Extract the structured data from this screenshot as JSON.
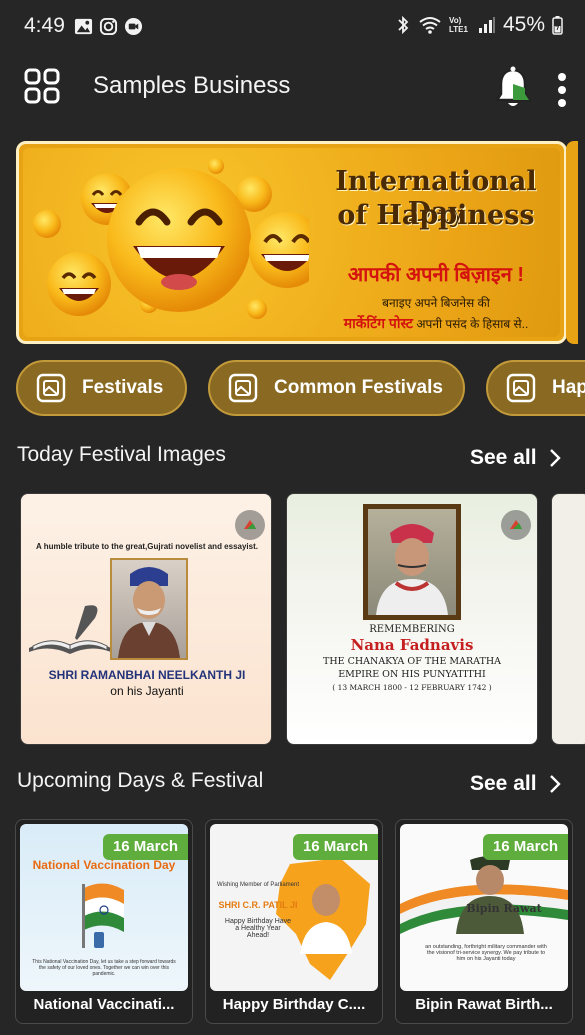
{
  "status_bar": {
    "time": "4:49",
    "signal_text": "Vo) LTE1",
    "battery": "45%"
  },
  "app_bar": {
    "title": "Samples Business",
    "menu_icon": "grid-icon",
    "notification_icon": "bell-icon",
    "more_icon": "kebab-icon"
  },
  "banner": {
    "line1": "International Day",
    "line2": "of Happiness",
    "hindi_title": "आपकी अपनी बिज़ाइन !",
    "hindi_line1": "बनाइए अपने बिजनेस की",
    "hindi_highlight": "मार्केटिंग पोस्ट",
    "hindi_line2": "अपनी पसंद के हिसाब से.."
  },
  "categories": [
    {
      "label": "Festivals"
    },
    {
      "label": "Common Festivals"
    },
    {
      "label": "Hap"
    }
  ],
  "today_section": {
    "title": "Today Festival Images",
    "see_all": "See all",
    "cards": [
      {
        "tribute": "A humble tribute to the great,Gujrati novelist and essayist.",
        "name": "SHRI RAMANBHAI NEELKANTH JI",
        "sub": "on his Jayanti"
      },
      {
        "remember": "REMEMBERING",
        "name": "Nana Fadnavis",
        "sub1": "THE CHANAKYA OF THE MARATHA",
        "sub2": "EMPIRE ON HIS PUNYATITHI",
        "dates": "( 13 MARCH 1800 - 12 FEBRUARY 1742 )"
      }
    ]
  },
  "upcoming_section": {
    "title": "Upcoming Days & Festival",
    "see_all": "See all",
    "cards": [
      {
        "date": "16 March",
        "label": "National Vaccinati...",
        "image_title": "National Vaccination Day",
        "image_text": "This National Vaccination Day, let us take a step forward towards the safety of our loved ones. Together we can win over this pandemic."
      },
      {
        "date": "16 March",
        "label": "Happy Birthday C....",
        "image_top": "Wishing Member of Parliament",
        "image_name": "SHRI C.R. PATIL JI",
        "image_text": "Happy Birthday Have a Healthy Year Ahead!"
      },
      {
        "date": "16 March",
        "label": "Bipin Rawat Birth...",
        "image_name": "Bipin Rawat",
        "image_text": "an outstanding, forthright military commander with the visionof tri-service synergy. We pay tribute to him on his Jayanti today"
      }
    ]
  },
  "colors": {
    "background": "#262626",
    "chip": "#8a6a22",
    "date_badge": "#5fae3d",
    "banner": "#e8a315"
  }
}
